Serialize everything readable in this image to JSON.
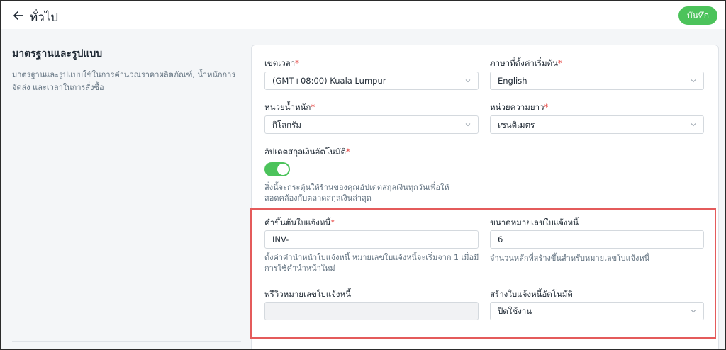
{
  "header": {
    "title": "ทั่วไป",
    "save_label": "บันทึก"
  },
  "section": {
    "title": "มาตรฐานและรูปแบบ",
    "description": "มาตรฐานและรูปแบบใช้ในการคำนวณราคาผลิตภัณฑ์, น้ำหนักการจัดส่ง และเวลาในการสั่งซื้อ"
  },
  "form": {
    "timezone": {
      "label": "เขตเวลา",
      "required": "*",
      "value": "(GMT+08:00) Kuala Lumpur"
    },
    "language": {
      "label": "ภาษาที่ตั้งค่าเริ่มต้น",
      "required": "*",
      "value": "English"
    },
    "weight_unit": {
      "label": "หน่วยน้ำหนัก",
      "required": "*",
      "value": "กิโลกรัม"
    },
    "length_unit": {
      "label": "หน่วยความยาว",
      "required": "*",
      "value": "เซนติเมตร"
    },
    "auto_currency": {
      "label": "อัปเดตสกุลเงินอัตโนมัติ",
      "required": "*",
      "enabled": true,
      "help": "สิ่งนี้จะกระตุ้นให้ร้านของคุณอัปเดตสกุลเงินทุกวันเพื่อให้สอดคล้องกับตลาดสกุลเงินล่าสุด"
    },
    "invoice_prefix": {
      "label": "คำขึ้นต้นใบแจ้งหนี้",
      "required": "*",
      "value": "INV-",
      "help": "ตั้งค่าคำนำหน้าใบแจ้งหนี้ หมายเลขใบแจ้งหนี้จะเริ่มจาก 1 เมื่อมีการใช้คำนำหน้าใหม่"
    },
    "invoice_number_size": {
      "label": "ขนาดหมายเลขใบแจ้งหนี้",
      "value": "6",
      "help": "จำนวนหลักที่สร้างขึ้นสำหรับหมายเลขใบแจ้งหนี้"
    },
    "invoice_preview": {
      "label": "พรีวิวหมายเลขใบแจ้งหนี้",
      "value": ""
    },
    "auto_invoice": {
      "label": "สร้างใบแจ้งหนี้อัตโนมัติ",
      "value": "ปิดใช้งาน"
    }
  },
  "colors": {
    "accent": "#4cc35b",
    "required": "#e53935",
    "highlight": "#e45b5b"
  },
  "icons": {
    "back": "arrow-left-icon",
    "dropdown": "chevron-down-icon"
  }
}
